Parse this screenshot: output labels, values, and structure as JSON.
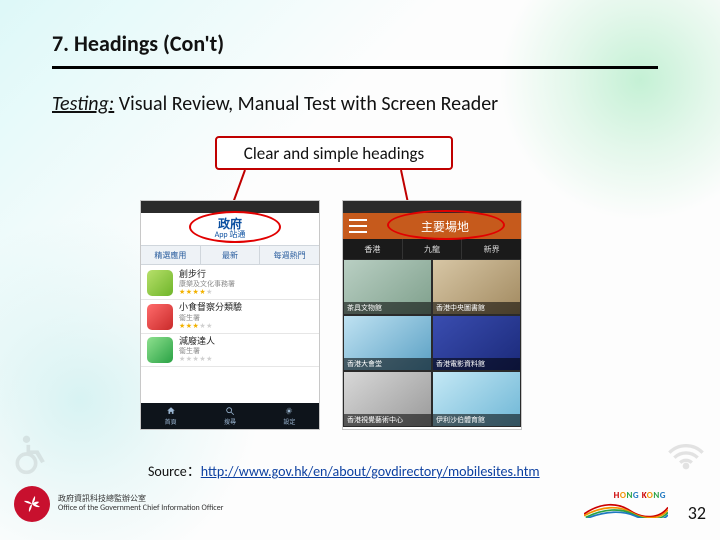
{
  "heading": "7. Headings (Con't)",
  "testing_prefix": "Testing:",
  "testing_rest": " Visual Review, Manual Test with Screen Reader",
  "callout": "Clear and simple headings",
  "phone1": {
    "title_cn": "政府",
    "title_en": "App 站通",
    "tabs": [
      "精選應用",
      "最新",
      "每週熱門"
    ],
    "rows": [
      {
        "name": "創步行",
        "sub": "康樂及文化事務署",
        "stars": 4,
        "color": "linear-gradient(135deg,#b7e06a,#6fb52a)"
      },
      {
        "name": "小食督察分類驗",
        "sub": "衞生署",
        "stars": 3,
        "color": "linear-gradient(135deg,#ff6b6b,#c92a2a)"
      },
      {
        "name": "減廢達人",
        "sub": "衞生署",
        "stars": 0,
        "color": "linear-gradient(135deg,#8ee08e,#2aa245)"
      }
    ],
    "bottom": [
      "首頁",
      "搜尋",
      "設定"
    ]
  },
  "phone2": {
    "title": "主要場地",
    "tabs": [
      "香港",
      "九龍",
      "新界"
    ],
    "cells": [
      {
        "cap": "茶具文物館",
        "bg": "linear-gradient(140deg,#b9cfc3,#7fa08c)"
      },
      {
        "cap": "香港中央圖書館",
        "bg": "linear-gradient(140deg,#d7c6a5,#a28a60)"
      },
      {
        "cap": "香港大會堂",
        "bg": "linear-gradient(140deg,#bfe2f2,#5aa0c4)"
      },
      {
        "cap": "香港電影資料館",
        "bg": "linear-gradient(140deg,#3a4db0,#1b2a7a)"
      },
      {
        "cap": "香港視覺藝術中心",
        "bg": "linear-gradient(140deg,#d8d8d8,#9a9a9a)"
      },
      {
        "cap": "伊利沙伯體育館",
        "bg": "linear-gradient(140deg,#c4e8f5,#6fb7d6)"
      }
    ]
  },
  "source_label": "Source：",
  "source_url": "http://www.gov.hk/en/about/govdirectory/mobilesites.htm",
  "ogcio_cn": "政府資訊科技總監辦公室",
  "ogcio_en": "Office of the Government Chief Information Officer",
  "brand": {
    "h": "H",
    "o": "O",
    "n": "N",
    "g": "G",
    "k": "K",
    "o2": "O",
    "n2": "N",
    "g2": "G"
  },
  "page_number": "32"
}
